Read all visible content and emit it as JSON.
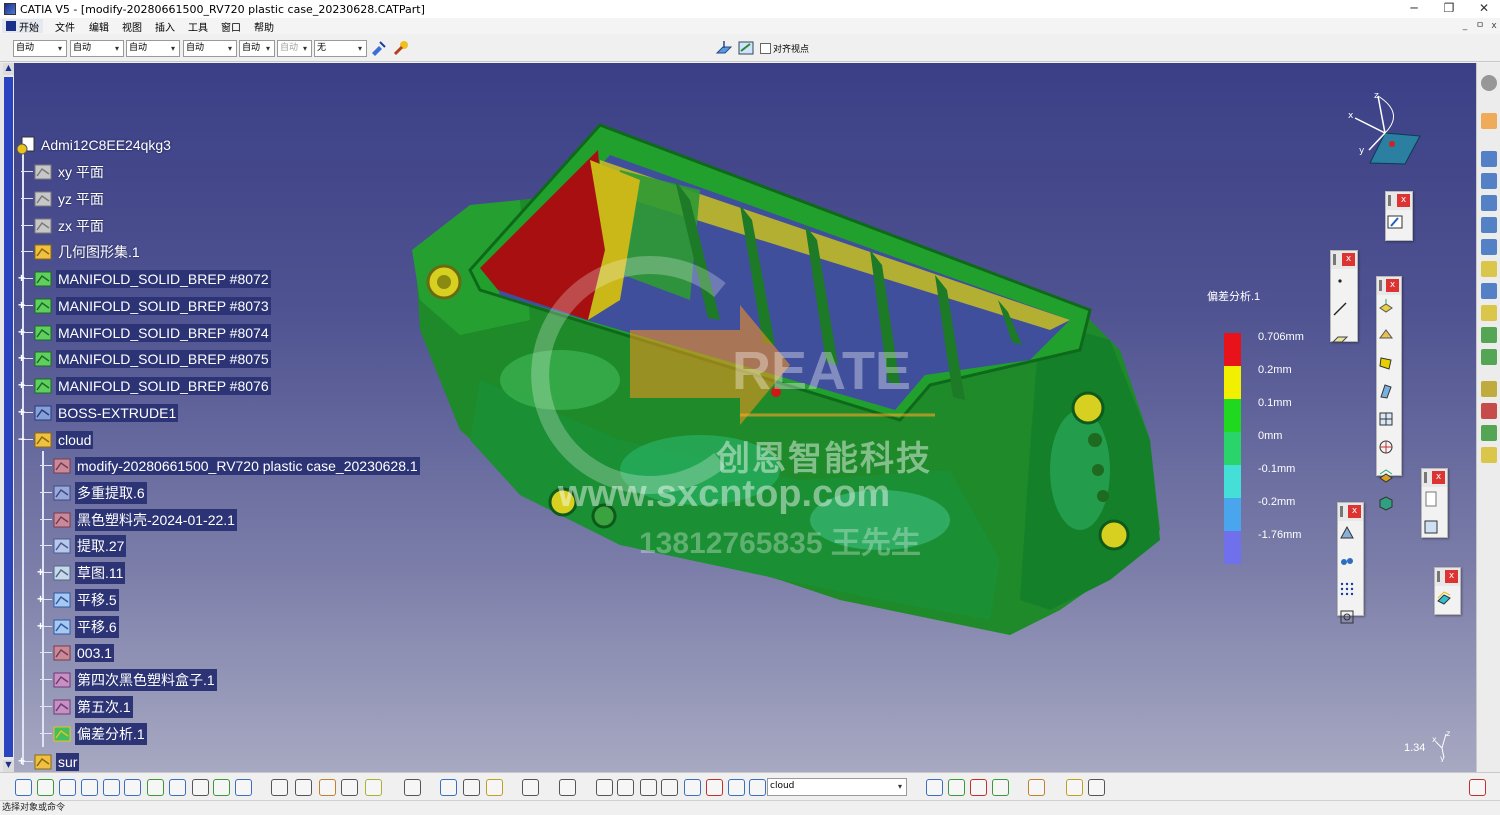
{
  "window": {
    "title": "CATIA V5 - [modify-20280661500_RV720 plastic case_20230628.CATPart]",
    "controls": [
      "─",
      "❐",
      "✕"
    ],
    "mdi_controls": [
      "_",
      "ㅁ",
      "x"
    ]
  },
  "menu": {
    "start": "开始",
    "items": [
      "文件",
      "编辑",
      "视图",
      "插入",
      "工具",
      "窗口",
      "帮助"
    ]
  },
  "style_toolbar": {
    "combos": [
      "自动",
      "自动",
      "自动",
      "自动",
      "自动",
      "自动",
      "无"
    ],
    "align_checkbox_label": "对齐视点",
    "align_checked": false
  },
  "tree": {
    "root": "Admi12C8EE24qkg3",
    "nodes": [
      {
        "label": "xy 平面",
        "icon": "plane-icon",
        "expander": ""
      },
      {
        "label": "yz 平面",
        "icon": "plane-icon",
        "expander": ""
      },
      {
        "label": "zx 平面",
        "icon": "plane-icon",
        "expander": ""
      },
      {
        "label": "几何图形集.1",
        "icon": "geometrical-set-icon",
        "expander": ""
      },
      {
        "label": "MANIFOLD_SOLID_BREP #8072",
        "icon": "solid-icon",
        "expander": "+"
      },
      {
        "label": "MANIFOLD_SOLID_BREP #8073",
        "icon": "solid-icon",
        "expander": "+"
      },
      {
        "label": "MANIFOLD_SOLID_BREP #8074",
        "icon": "solid-icon",
        "expander": "+"
      },
      {
        "label": "MANIFOLD_SOLID_BREP #8075",
        "icon": "solid-icon",
        "expander": "+"
      },
      {
        "label": "MANIFOLD_SOLID_BREP #8076",
        "icon": "solid-icon",
        "expander": "+"
      },
      {
        "label": "BOSS-EXTRUDE1",
        "icon": "extrude-icon",
        "expander": "+"
      },
      {
        "label": "cloud",
        "icon": "geometrical-set-icon",
        "expander": "−"
      }
    ],
    "children": [
      {
        "label": "modify-20280661500_RV720 plastic case_20230628.1",
        "icon": "mesh-icon",
        "expander": ""
      },
      {
        "label": "多重提取.6",
        "icon": "multi-extract-icon",
        "expander": ""
      },
      {
        "label": "黑色塑料壳-2024-01-22.1",
        "icon": "mesh-icon",
        "expander": ""
      },
      {
        "label": "提取.27",
        "icon": "extract-icon",
        "expander": ""
      },
      {
        "label": "草图.11",
        "icon": "sketch-icon",
        "expander": "+"
      },
      {
        "label": "平移.5",
        "icon": "translate-icon",
        "expander": "+"
      },
      {
        "label": "平移.6",
        "icon": "translate-icon",
        "expander": "+"
      },
      {
        "label": "003.1",
        "icon": "mesh-icon",
        "expander": ""
      },
      {
        "label": "第四次黑色塑料盒子.1",
        "icon": "scan-icon",
        "expander": ""
      },
      {
        "label": "第五次.1",
        "icon": "scan-icon",
        "expander": ""
      },
      {
        "label": "偏差分析.1",
        "icon": "deviation-icon",
        "expander": ""
      }
    ],
    "last": {
      "label": "sur",
      "icon": "geometrical-set-icon",
      "expander": "+"
    }
  },
  "legend": {
    "title": "偏差分析.1",
    "labels": [
      "0.706mm",
      "0.2mm",
      "0.1mm",
      "0mm",
      "-0.1mm",
      "-0.2mm",
      "-1.76mm"
    ],
    "colors": [
      "#e8121a",
      "#f0f000",
      "#1fd81f",
      "#2ad46a",
      "#44e0d8",
      "#4aa6ec",
      "#7070ec"
    ]
  },
  "compass": {
    "x": "x",
    "y": "y",
    "z": "z"
  },
  "scale_readout": {
    "value": "1.34",
    "x": "x",
    "y": "y",
    "z": "z"
  },
  "watermark": {
    "brand": "REATE",
    "cn": "创恩智能科技",
    "url": "www.sxcntop.com",
    "phone": "13812765835 王先生"
  },
  "bottom_toolbar": {
    "combo_value": "cloud"
  },
  "status": "选择对象或命令",
  "colors": {
    "viewport_top": "#3b3f86",
    "viewport_bottom": "#a7a9c2",
    "tree_label_bg": "#2c3475",
    "model_green": "#1e9a2e",
    "model_red": "#b20f10",
    "model_yellow": "#d9cf1c"
  }
}
